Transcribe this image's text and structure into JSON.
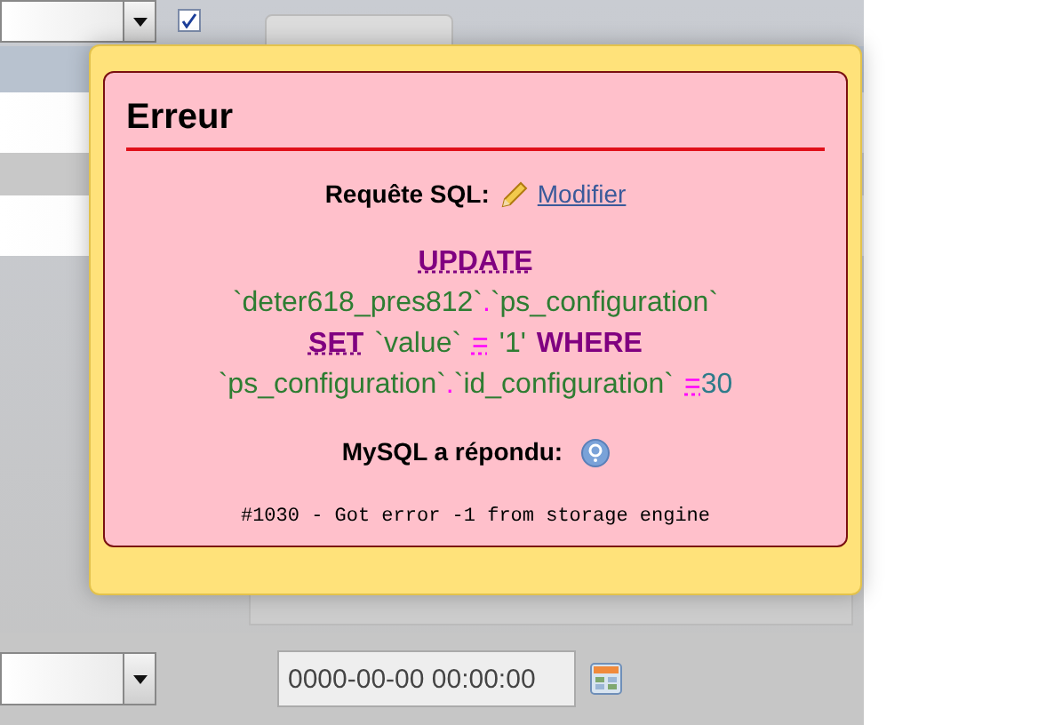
{
  "background": {
    "checkbox": {
      "checked": true
    },
    "datetime_field": {
      "value": "0000-00-00 00:00:00"
    }
  },
  "error_dialog": {
    "title": "Erreur",
    "query_label": "Requête SQL:",
    "edit_link": "Modifier",
    "sql_lines": [
      [
        {
          "kind": "keyword_link",
          "text": "UPDATE"
        }
      ],
      [
        {
          "kind": "identifier",
          "text": "`deter618_pres812`"
        },
        {
          "kind": "punct",
          "text": "."
        },
        {
          "kind": "identifier",
          "text": "`ps_configuration`"
        }
      ],
      [
        {
          "kind": "keyword_link",
          "text": "SET"
        },
        {
          "kind": "identifier",
          "text": "`value`"
        },
        {
          "kind": "operator",
          "text": "="
        },
        {
          "kind": "string",
          "text": "'1'"
        },
        {
          "kind": "keyword",
          "text": "WHERE"
        }
      ],
      [
        {
          "kind": "identifier",
          "text": "`ps_configuration`"
        },
        {
          "kind": "punct",
          "text": "."
        },
        {
          "kind": "identifier",
          "text": "`id_configuration`"
        },
        {
          "kind": "operator",
          "text": "="
        },
        {
          "kind": "number",
          "text": "30"
        }
      ]
    ],
    "response_label": "MySQL a répondu:",
    "error_message": "#1030 - Got error -1 from storage engine"
  }
}
